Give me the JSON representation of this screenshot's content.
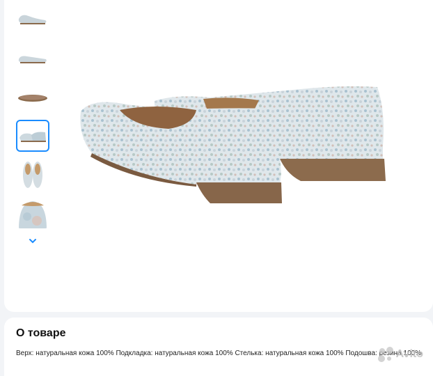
{
  "gallery": {
    "thumbnails": [
      {
        "label": "thumb-side-view"
      },
      {
        "label": "thumb-side-view-2"
      },
      {
        "label": "thumb-sole-view"
      },
      {
        "label": "thumb-pair-rear-view",
        "active": true
      },
      {
        "label": "thumb-top-view"
      },
      {
        "label": "thumb-toe-closeup"
      }
    ],
    "more_icon": "chevron-down-icon",
    "accent_color": "#1a8cff"
  },
  "about": {
    "title": "О товаре",
    "description": "Верх: натуральная кожа 100% Подкладка: натуральная кожа 100% Стелька: натуральная кожа 100% Подошва: резина 100%"
  },
  "watermark": {
    "text": "Avito"
  }
}
